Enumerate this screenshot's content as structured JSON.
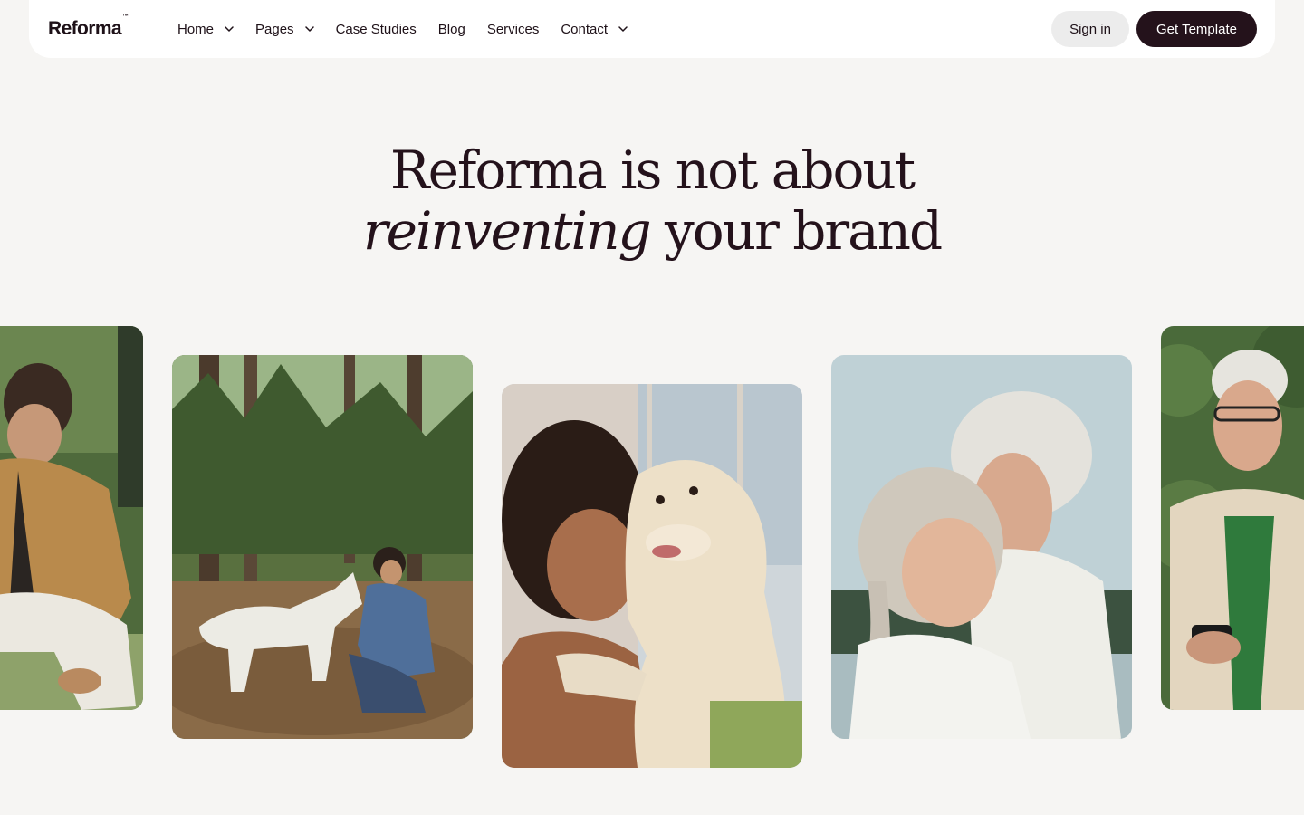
{
  "brand": {
    "name": "Reforma",
    "trademark": "™"
  },
  "nav": {
    "items": [
      {
        "label": "Home",
        "has_dropdown": true
      },
      {
        "label": "Pages",
        "has_dropdown": true
      },
      {
        "label": "Case Studies",
        "has_dropdown": false
      },
      {
        "label": "Blog",
        "has_dropdown": false
      },
      {
        "label": "Services",
        "has_dropdown": false
      },
      {
        "label": "Contact",
        "has_dropdown": true
      }
    ],
    "signin_label": "Sign in",
    "cta_label": "Get Template"
  },
  "hero": {
    "line1": "Reforma is not about",
    "line2_italic": "reinventing",
    "line2_rest": " your brand"
  },
  "gallery": [
    {
      "name": "photo-man-crouching"
    },
    {
      "name": "photo-woman-with-white-dog-forest"
    },
    {
      "name": "photo-woman-hugging-dog"
    },
    {
      "name": "photo-elderly-couple"
    },
    {
      "name": "photo-older-man-phone"
    }
  ],
  "colors": {
    "background": "#f6f5f3",
    "text": "#24121b",
    "primary_button": "#24121b",
    "secondary_button": "#ececec"
  }
}
